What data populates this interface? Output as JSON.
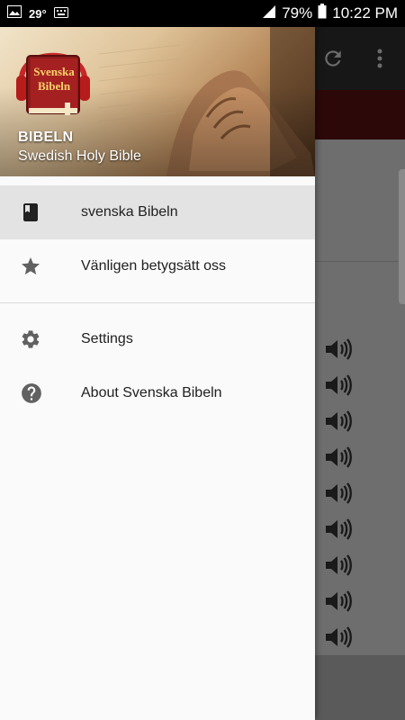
{
  "status_bar": {
    "temperature": "29°",
    "battery": "79%",
    "time": "10:22 PM"
  },
  "drawer": {
    "header": {
      "logo_line1": "Svenska",
      "logo_line2": "Bibeln",
      "title": "BIBELN",
      "subtitle": "Swedish Holy Bible"
    },
    "items": [
      {
        "label": "svenska Bibeln",
        "icon": "book-icon",
        "active": true
      },
      {
        "label": "Vänligen betygsätt oss",
        "icon": "star-icon",
        "active": false
      },
      {
        "label": "Settings",
        "icon": "gear-icon",
        "active": false
      },
      {
        "label": "About Svenska Bibeln",
        "icon": "help-icon",
        "active": false
      }
    ]
  },
  "background": {
    "toolbar_icons": [
      "refresh-icon",
      "more-vert-icon"
    ],
    "speaker_rows": 9
  }
}
